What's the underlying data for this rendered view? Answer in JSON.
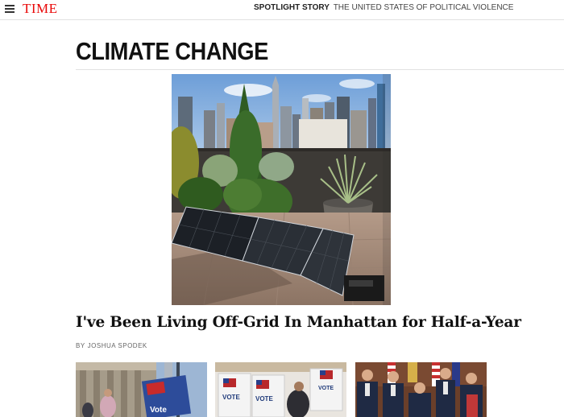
{
  "header": {
    "logo": "TIME",
    "spotlight_label": "SPOTLIGHT STORY",
    "spotlight_title": "THE UNITED STATES OF POLITICAL VIOLENCE"
  },
  "section": {
    "title": "CLIMATE CHANGE"
  },
  "feature": {
    "headline": "I've Been Living Off-Grid In Manhattan for Half-a-Year",
    "byline_label": "BY",
    "author": "JOSHUA SPODEK"
  },
  "thumbnails": [
    {
      "sign_text": "Vote"
    },
    {
      "sign_text_1": "VOTE",
      "sign_text_2": "VOTE",
      "sign_text_3": "VOTE"
    },
    {}
  ],
  "colors": {
    "logo_red": "#e90606",
    "sky": "#7fa9dc"
  },
  "icons": [
    "menu-icon"
  ]
}
